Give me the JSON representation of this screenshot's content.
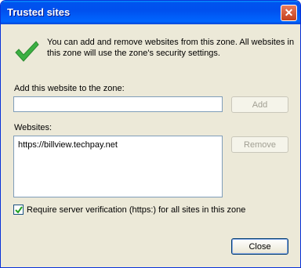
{
  "window": {
    "title": "Trusted sites"
  },
  "info": {
    "text": "You can add and remove websites from this zone. All websites in this zone will use the zone's security settings."
  },
  "add": {
    "label": "Add this website to the zone:",
    "value": "",
    "button": "Add"
  },
  "websites": {
    "label": "Websites:",
    "items": [
      "https://billview.techpay.net"
    ],
    "remove_button": "Remove"
  },
  "require_https": {
    "label": "Require server verification (https:) for all sites in this zone",
    "checked": true
  },
  "footer": {
    "close_button": "Close"
  },
  "colors": {
    "titlebar": "#0054e3",
    "dialog_bg": "#ece9d8",
    "check_green": "#3cb043"
  }
}
